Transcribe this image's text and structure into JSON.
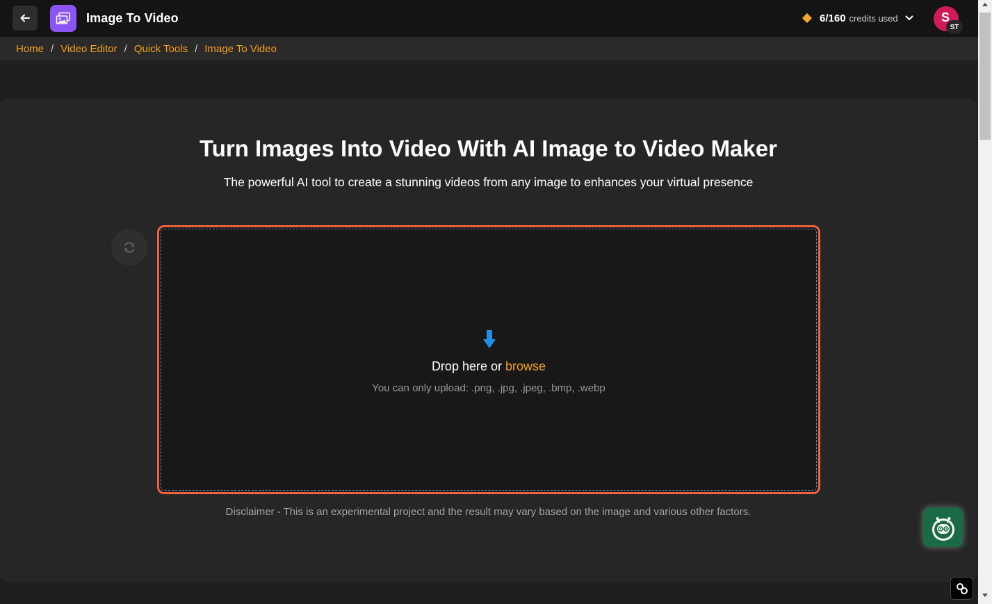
{
  "header": {
    "title": "Image To Video",
    "credits_count": "6/160",
    "credits_label": "credits used",
    "avatar_initial": "S",
    "avatar_badge": "ST"
  },
  "breadcrumb": {
    "items": [
      "Home",
      "Video Editor",
      "Quick Tools",
      "Image To Video"
    ],
    "separator": "/"
  },
  "main": {
    "headline": "Turn Images Into Video With AI Image to Video Maker",
    "subline": "The powerful AI tool to create a stunning videos from any image to enhances your virtual presence",
    "dropzone": {
      "prompt": "Drop here or",
      "browse_label": "browse",
      "hint": "You can only upload: .png, .jpg, .jpeg, .bmp, .webp"
    },
    "disclaimer": "Disclaimer - This is an experimental project and the result may vary based on the image and various other factors."
  },
  "colors": {
    "accent": "#f5a11c",
    "logo": "#8a55f7",
    "dropzone_border": "#f0623d",
    "avatar": "#d11a5a",
    "bot": "#1a6b45"
  },
  "icons": {
    "back": "arrow-left-icon",
    "logo": "image-video-icon",
    "credits": "diamond-icon",
    "dropdown": "chevron-down-icon",
    "refresh": "refresh-icon",
    "upload": "arrow-down-icon",
    "bot": "robot-icon",
    "extension": "link-icon"
  }
}
